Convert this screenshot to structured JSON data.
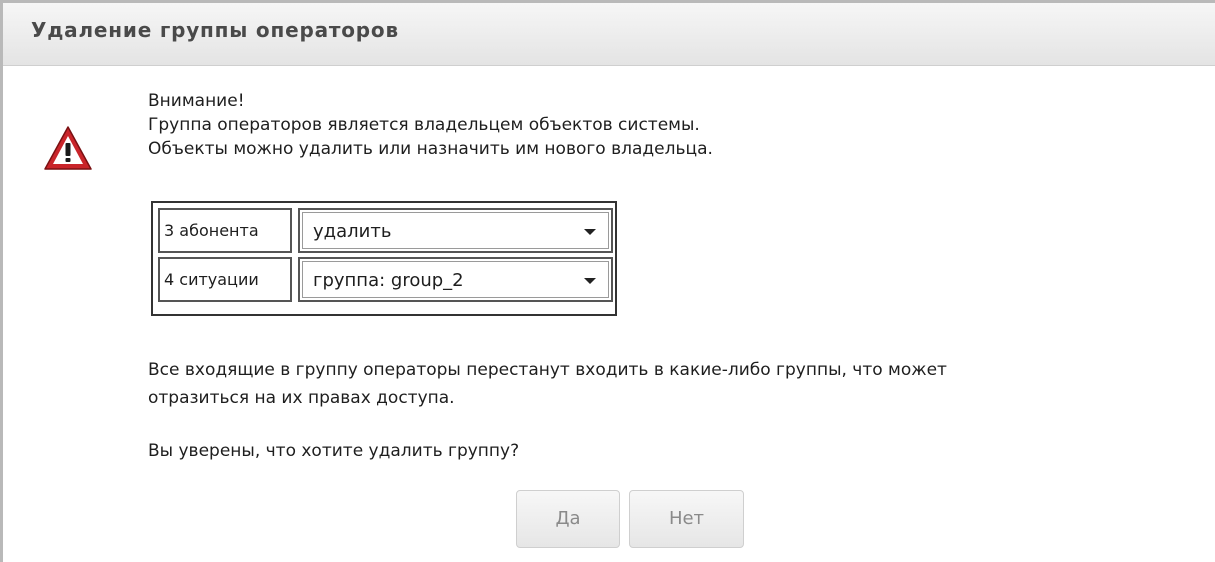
{
  "dialog": {
    "title": "Удаление группы операторов"
  },
  "warning": {
    "icon": "warning-triangle-icon",
    "lines": [
      "Внимание!",
      "Группа операторов является владельцем объектов системы.",
      "Объекты можно удалить или назначить им нового владельца."
    ]
  },
  "owner_table": {
    "rows": [
      {
        "label": "3 абонента",
        "selected": "удалить"
      },
      {
        "label": "4 ситуации",
        "selected": "группа: group_2"
      }
    ]
  },
  "notice": {
    "line1": "Все входящие в группу операторы перестанут входить в какие-либо группы, что может",
    "line2": "отразиться на их правах доступа."
  },
  "question": "Вы уверены, что хотите удалить группу?",
  "buttons": {
    "yes_label": "Да",
    "no_label": "Нет"
  },
  "colors": {
    "warning_red": "#c9252a",
    "title_text": "#4a4a4a"
  }
}
